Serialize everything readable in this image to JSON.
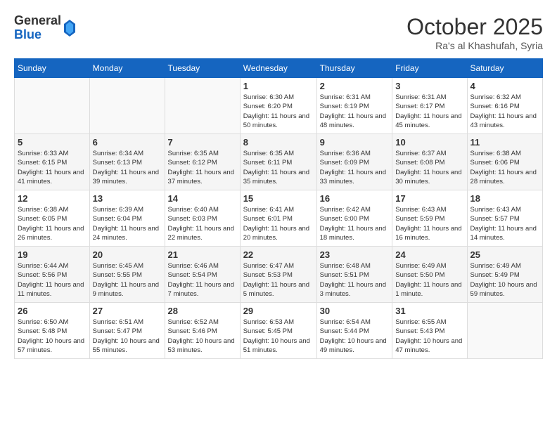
{
  "header": {
    "logo_general": "General",
    "logo_blue": "Blue",
    "month_title": "October 2025",
    "location": "Ra's al Khashufah, Syria"
  },
  "weekdays": [
    "Sunday",
    "Monday",
    "Tuesday",
    "Wednesday",
    "Thursday",
    "Friday",
    "Saturday"
  ],
  "weeks": [
    [
      {
        "day": "",
        "info": ""
      },
      {
        "day": "",
        "info": ""
      },
      {
        "day": "",
        "info": ""
      },
      {
        "day": "1",
        "info": "Sunrise: 6:30 AM\nSunset: 6:20 PM\nDaylight: 11 hours and 50 minutes."
      },
      {
        "day": "2",
        "info": "Sunrise: 6:31 AM\nSunset: 6:19 PM\nDaylight: 11 hours and 48 minutes."
      },
      {
        "day": "3",
        "info": "Sunrise: 6:31 AM\nSunset: 6:17 PM\nDaylight: 11 hours and 45 minutes."
      },
      {
        "day": "4",
        "info": "Sunrise: 6:32 AM\nSunset: 6:16 PM\nDaylight: 11 hours and 43 minutes."
      }
    ],
    [
      {
        "day": "5",
        "info": "Sunrise: 6:33 AM\nSunset: 6:15 PM\nDaylight: 11 hours and 41 minutes."
      },
      {
        "day": "6",
        "info": "Sunrise: 6:34 AM\nSunset: 6:13 PM\nDaylight: 11 hours and 39 minutes."
      },
      {
        "day": "7",
        "info": "Sunrise: 6:35 AM\nSunset: 6:12 PM\nDaylight: 11 hours and 37 minutes."
      },
      {
        "day": "8",
        "info": "Sunrise: 6:35 AM\nSunset: 6:11 PM\nDaylight: 11 hours and 35 minutes."
      },
      {
        "day": "9",
        "info": "Sunrise: 6:36 AM\nSunset: 6:09 PM\nDaylight: 11 hours and 33 minutes."
      },
      {
        "day": "10",
        "info": "Sunrise: 6:37 AM\nSunset: 6:08 PM\nDaylight: 11 hours and 30 minutes."
      },
      {
        "day": "11",
        "info": "Sunrise: 6:38 AM\nSunset: 6:06 PM\nDaylight: 11 hours and 28 minutes."
      }
    ],
    [
      {
        "day": "12",
        "info": "Sunrise: 6:38 AM\nSunset: 6:05 PM\nDaylight: 11 hours and 26 minutes."
      },
      {
        "day": "13",
        "info": "Sunrise: 6:39 AM\nSunset: 6:04 PM\nDaylight: 11 hours and 24 minutes."
      },
      {
        "day": "14",
        "info": "Sunrise: 6:40 AM\nSunset: 6:03 PM\nDaylight: 11 hours and 22 minutes."
      },
      {
        "day": "15",
        "info": "Sunrise: 6:41 AM\nSunset: 6:01 PM\nDaylight: 11 hours and 20 minutes."
      },
      {
        "day": "16",
        "info": "Sunrise: 6:42 AM\nSunset: 6:00 PM\nDaylight: 11 hours and 18 minutes."
      },
      {
        "day": "17",
        "info": "Sunrise: 6:43 AM\nSunset: 5:59 PM\nDaylight: 11 hours and 16 minutes."
      },
      {
        "day": "18",
        "info": "Sunrise: 6:43 AM\nSunset: 5:57 PM\nDaylight: 11 hours and 14 minutes."
      }
    ],
    [
      {
        "day": "19",
        "info": "Sunrise: 6:44 AM\nSunset: 5:56 PM\nDaylight: 11 hours and 11 minutes."
      },
      {
        "day": "20",
        "info": "Sunrise: 6:45 AM\nSunset: 5:55 PM\nDaylight: 11 hours and 9 minutes."
      },
      {
        "day": "21",
        "info": "Sunrise: 6:46 AM\nSunset: 5:54 PM\nDaylight: 11 hours and 7 minutes."
      },
      {
        "day": "22",
        "info": "Sunrise: 6:47 AM\nSunset: 5:53 PM\nDaylight: 11 hours and 5 minutes."
      },
      {
        "day": "23",
        "info": "Sunrise: 6:48 AM\nSunset: 5:51 PM\nDaylight: 11 hours and 3 minutes."
      },
      {
        "day": "24",
        "info": "Sunrise: 6:49 AM\nSunset: 5:50 PM\nDaylight: 11 hours and 1 minute."
      },
      {
        "day": "25",
        "info": "Sunrise: 6:49 AM\nSunset: 5:49 PM\nDaylight: 10 hours and 59 minutes."
      }
    ],
    [
      {
        "day": "26",
        "info": "Sunrise: 6:50 AM\nSunset: 5:48 PM\nDaylight: 10 hours and 57 minutes."
      },
      {
        "day": "27",
        "info": "Sunrise: 6:51 AM\nSunset: 5:47 PM\nDaylight: 10 hours and 55 minutes."
      },
      {
        "day": "28",
        "info": "Sunrise: 6:52 AM\nSunset: 5:46 PM\nDaylight: 10 hours and 53 minutes."
      },
      {
        "day": "29",
        "info": "Sunrise: 6:53 AM\nSunset: 5:45 PM\nDaylight: 10 hours and 51 minutes."
      },
      {
        "day": "30",
        "info": "Sunrise: 6:54 AM\nSunset: 5:44 PM\nDaylight: 10 hours and 49 minutes."
      },
      {
        "day": "31",
        "info": "Sunrise: 6:55 AM\nSunset: 5:43 PM\nDaylight: 10 hours and 47 minutes."
      },
      {
        "day": "",
        "info": ""
      }
    ]
  ]
}
